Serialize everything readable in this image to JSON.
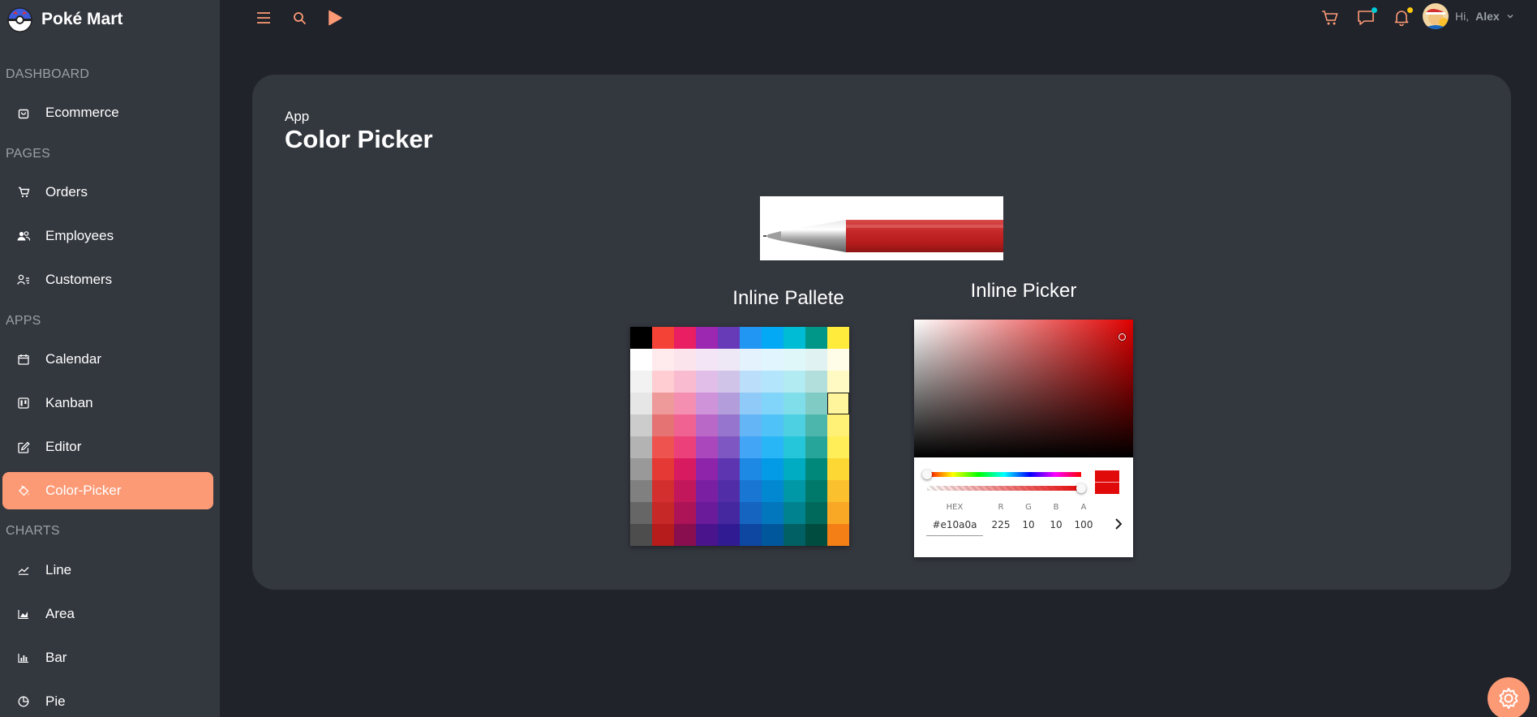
{
  "brand": {
    "name": "Poké Mart"
  },
  "sidebar": {
    "sections": {
      "dashboard": "DASHBOARD",
      "pages": "PAGES",
      "apps": "APPS",
      "charts": "CHARTS"
    },
    "items": {
      "ecommerce": "Ecommerce",
      "orders": "Orders",
      "employees": "Employees",
      "customers": "Customers",
      "calendar": "Calendar",
      "kanban": "Kanban",
      "editor": "Editor",
      "color_picker": "Color-Picker",
      "line": "Line",
      "area": "Area",
      "bar": "Bar",
      "pie": "Pie"
    },
    "active": "Color-Picker"
  },
  "topbar": {
    "user": {
      "greeting": "Hi,",
      "name": "Alex"
    },
    "accent_color": "#fd9a76"
  },
  "main": {
    "breadcrumb": "App",
    "title": "Color Picker",
    "pallete_title": "Inline Pallete",
    "picker_title": "Inline Picker"
  },
  "pallete": {
    "colors": [
      [
        "#000000",
        "#f44336",
        "#e91e63",
        "#9c27b0",
        "#673ab7",
        "#2196f3",
        "#03a9f4",
        "#00bcd4",
        "#009688",
        "#ffeb3b"
      ],
      [
        "#ffffff",
        "#ffebee",
        "#fce4ec",
        "#f3e5f5",
        "#ede7f6",
        "#e3f2fd",
        "#e1f5fe",
        "#e0f7fa",
        "#e0f2f1",
        "#fffde7"
      ],
      [
        "#f2f2f2",
        "#ffcdd2",
        "#f8bbd0",
        "#e1bee7",
        "#d1c4e9",
        "#bbdefb",
        "#b3e5fc",
        "#b2ebf2",
        "#b2dfdb",
        "#fff9c4"
      ],
      [
        "#e6e6e6",
        "#ef9a9a",
        "#f48fb1",
        "#ce93d8",
        "#b39ddb",
        "#90caf9",
        "#81d4fa",
        "#80deea",
        "#80cbc4",
        "#fff59d"
      ],
      [
        "#cccccc",
        "#e57373",
        "#f06292",
        "#ba68c8",
        "#9575cd",
        "#64b5f6",
        "#4fc3f7",
        "#4dd0e1",
        "#4db6ac",
        "#fff176"
      ],
      [
        "#b3b3b3",
        "#ef5350",
        "#ec407a",
        "#ab47bc",
        "#7e57c2",
        "#42a5f5",
        "#29b6f6",
        "#26c6da",
        "#26a69a",
        "#ffee58"
      ],
      [
        "#999999",
        "#e53935",
        "#d81b60",
        "#8e24aa",
        "#5e35b1",
        "#1e88e5",
        "#039be5",
        "#00acc1",
        "#00897b",
        "#fdd835"
      ],
      [
        "#808080",
        "#d32f2f",
        "#c2185b",
        "#7b1fa2",
        "#512da8",
        "#1976d2",
        "#0288d1",
        "#0097a7",
        "#00796b",
        "#fbc02d"
      ],
      [
        "#666666",
        "#c62828",
        "#ad1457",
        "#6a1b9a",
        "#4527a0",
        "#1565c0",
        "#0277bd",
        "#00838f",
        "#00695c",
        "#f9a825"
      ],
      [
        "#4d4d4d",
        "#b71c1c",
        "#880e4f",
        "#4a148c",
        "#311b92",
        "#0d47a1",
        "#01579b",
        "#006064",
        "#004d40",
        "#f57f17"
      ]
    ],
    "selected": [
      3,
      9
    ]
  },
  "picker": {
    "hex_label": "HEX",
    "r_label": "R",
    "g_label": "G",
    "b_label": "B",
    "a_label": "A",
    "hex": "#e10a0a",
    "r": "225",
    "g": "10",
    "b": "10",
    "a": "100"
  }
}
